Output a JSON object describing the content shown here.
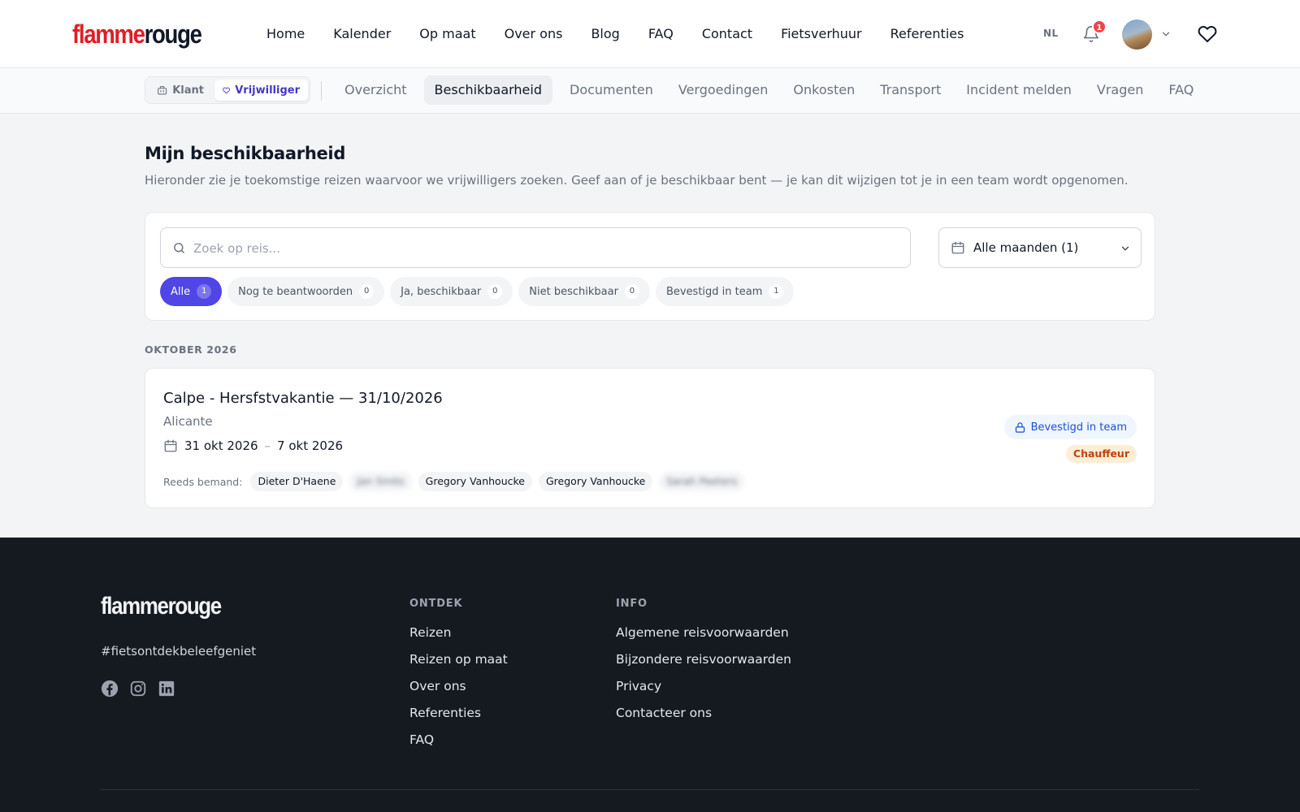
{
  "header": {
    "logo_part1": "flamme",
    "logo_part2": "rouge",
    "nav": [
      "Home",
      "Kalender",
      "Op maat",
      "Over ons",
      "Blog",
      "FAQ",
      "Contact",
      "Fietsverhuur",
      "Referenties"
    ],
    "language": "NL",
    "notification_count": "1",
    "icons": [
      "bell-icon",
      "chevron-down-icon",
      "heart-icon"
    ]
  },
  "subnav": {
    "roles": {
      "klant": "Klant",
      "vrijwilliger": "Vrijwilliger",
      "active": "vrijwilliger"
    },
    "tabs": [
      "Overzicht",
      "Beschikbaarheid",
      "Documenten",
      "Vergoedingen",
      "Onkosten",
      "Transport",
      "Incident melden",
      "Vragen",
      "FAQ"
    ],
    "active_tab": "Beschikbaarheid"
  },
  "page": {
    "title": "Mijn beschikbaarheid",
    "subtitle": "Hieronder zie je toekomstige reizen waarvoor we vrijwilligers zoeken. Geef aan of je beschikbaar bent — je kan dit wijzigen tot je in een team wordt opgenomen."
  },
  "filters": {
    "search_placeholder": "Zoek op reis...",
    "search_value": "",
    "month_select": "Alle maanden (1)",
    "pills": [
      {
        "label": "Alle",
        "count": "1",
        "active": true
      },
      {
        "label": "Nog te beantwoorden",
        "count": "0",
        "active": false
      },
      {
        "label": "Ja, beschikbaar",
        "count": "0",
        "active": false
      },
      {
        "label": "Niet beschikbaar",
        "count": "0",
        "active": false
      },
      {
        "label": "Bevestigd in team",
        "count": "1",
        "active": false
      }
    ]
  },
  "trips": {
    "month_heading": "OKTOBER 2026",
    "item": {
      "title": "Calpe - Hersfstvakantie — 31/10/2026",
      "location": "Alicante",
      "date_start": "31 okt 2026",
      "date_sep": "–",
      "date_end": "7 okt 2026",
      "staffed_label": "Reeds bemand:",
      "people": [
        "Dieter D'Haene",
        "Jan Smits",
        "Gregory Vanhoucke",
        "Gregory Vanhoucke",
        "Sarah Peeters"
      ],
      "status": "Bevestigd in team",
      "role": "Chauffeur"
    }
  },
  "footer": {
    "logo": "flammerouge",
    "tagline": "#fietsontdekbeleefgeniet",
    "social": [
      "facebook-icon",
      "instagram-icon",
      "linkedin-icon"
    ],
    "col1": {
      "heading": "ONTDEK",
      "links": [
        "Reizen",
        "Reizen op maat",
        "Over ons",
        "Referenties",
        "FAQ"
      ]
    },
    "col2": {
      "heading": "INFO",
      "links": [
        "Algemene reisvoorwaarden",
        "Bijzondere reisvoorwaarden",
        "Privacy",
        "Contacteer ons"
      ]
    }
  },
  "colors": {
    "brand_red": "#e11d24",
    "accent": "#4f46e5",
    "status_blue": "#1d4ed8",
    "role_orange": "#c2410c",
    "footer_bg": "#151a21"
  }
}
